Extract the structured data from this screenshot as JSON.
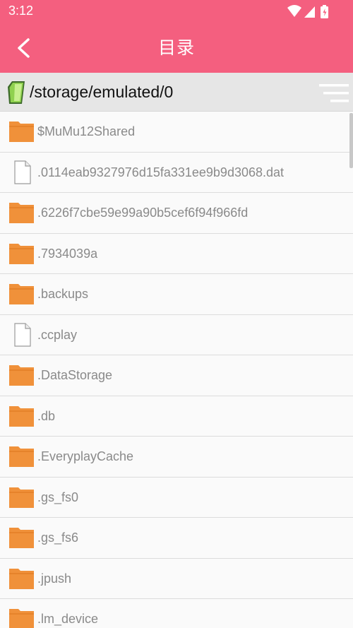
{
  "status_bar": {
    "time": "3:12",
    "icons": [
      "wifi-icon",
      "cell-signal-icon",
      "battery-charging-icon"
    ]
  },
  "app_bar": {
    "title": "目录",
    "back_icon": "chevron-left-icon",
    "color": "#f45f7f"
  },
  "path_bar": {
    "path": "/storage/emulated/0",
    "storage_icon": "sd-card-icon",
    "sort_icon": "sort-icon"
  },
  "files": [
    {
      "name": "$MuMu12Shared",
      "type": "folder"
    },
    {
      "name": ".0114eab9327976d15fa331ee9b9d3068.dat",
      "type": "file"
    },
    {
      "name": ".6226f7cbe59e99a90b5cef6f94f966fd",
      "type": "folder"
    },
    {
      "name": ".7934039a",
      "type": "folder"
    },
    {
      "name": ".backups",
      "type": "folder"
    },
    {
      "name": ".ccplay",
      "type": "file"
    },
    {
      "name": ".DataStorage",
      "type": "folder"
    },
    {
      "name": ".db",
      "type": "folder"
    },
    {
      "name": ".EveryplayCache",
      "type": "folder"
    },
    {
      "name": ".gs_fs0",
      "type": "folder"
    },
    {
      "name": ".gs_fs6",
      "type": "folder"
    },
    {
      "name": ".jpush",
      "type": "folder"
    },
    {
      "name": ".lm_device",
      "type": "folder"
    }
  ],
  "colors": {
    "folder": "#f0913a",
    "file_outline": "#9a9a9a"
  }
}
